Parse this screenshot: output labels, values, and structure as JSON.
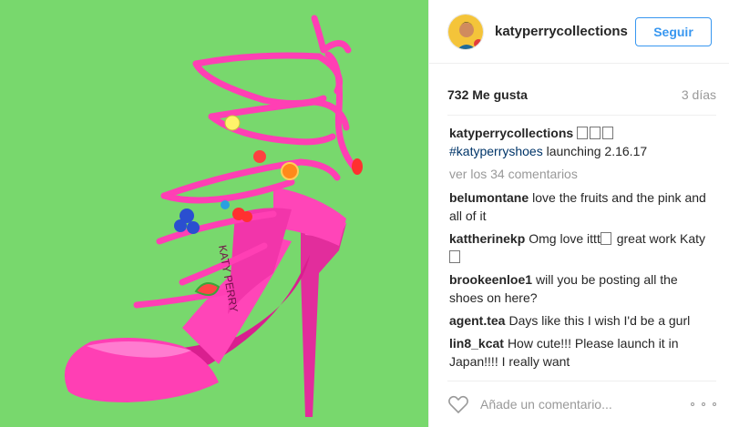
{
  "post": {
    "image_alt": "Pink strappy high-heel sandal decorated with fruit charms on a green background",
    "brand_text": "KATY PERRY"
  },
  "header": {
    "username": "katyperrycollections",
    "follow_label": "Seguir"
  },
  "stats": {
    "likes": "732 Me gusta",
    "time": "3 días"
  },
  "caption": {
    "user": "katyperrycollections",
    "emoji_count": 3,
    "hashtag": "#katyperryshoes",
    "text": " launching 2.16.17"
  },
  "view_all": "ver los 34 comentarios",
  "comments": [
    {
      "user": "belumontane",
      "text": "love the fruits and the pink and all of it"
    },
    {
      "user": "kattherinekp",
      "text": "Omg love ittt",
      "text2": " great work Katy"
    },
    {
      "user": "brookeenloe1",
      "text": "will you be posting all the shoes on here?"
    },
    {
      "user": "agent.tea",
      "text": "Days like this I wish I'd be a gurl"
    },
    {
      "user": "lin8_kcat",
      "text": "How cute!!! Please launch it in Japan!!!! I really want"
    }
  ],
  "footer": {
    "placeholder": "Añade un comentario..."
  },
  "colors": {
    "photo_bg": "#78d86d",
    "shoe": "#ff3fb4",
    "accent": "#3897f0"
  },
  "icons": [
    "heart-icon",
    "more-options-icon",
    "avatar"
  ]
}
